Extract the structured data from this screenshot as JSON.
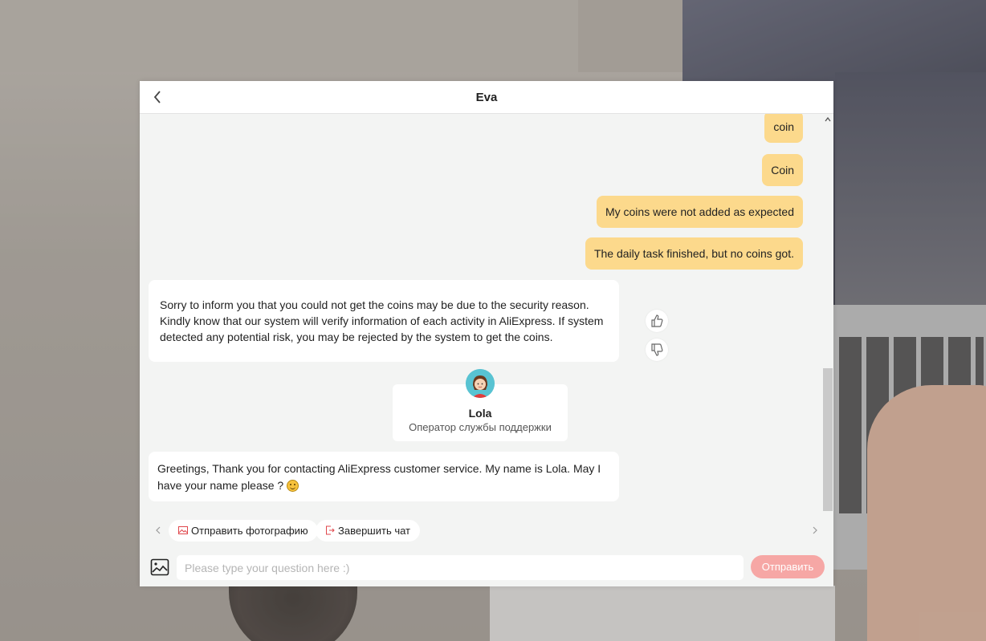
{
  "window": {
    "title": "Eva"
  },
  "messages": {
    "user": [
      "coin",
      "Coin",
      "My coins were not added as expected",
      "The daily task finished, but no coins got."
    ],
    "bot_reply": "Sorry to inform you that you could not get the coins may be due to the security reason. Kindly know that our system will verify information of each activity in AliExpress. If system detected any potential risk, you may be rejected by the system to get the coins.",
    "agent": {
      "name": "Lola",
      "role": "Оператор службы поддержки"
    },
    "greeting": "Greetings, Thank you for contacting AliExpress customer service. My name is Lola. May I have your name please ?"
  },
  "quick_actions": [
    {
      "label": "Отправить фотографию",
      "icon": "image-icon"
    },
    {
      "label": "Завершить чат",
      "icon": "exit-icon"
    }
  ],
  "input": {
    "placeholder": "Please type your question here :)",
    "value": ""
  },
  "send_button": {
    "label": "Отправить"
  },
  "colors": {
    "user_bubble": "#fcd98c",
    "bot_bubble": "#ffffff",
    "send_button": "#f6a7a5",
    "chat_background": "#f3f4f3"
  }
}
